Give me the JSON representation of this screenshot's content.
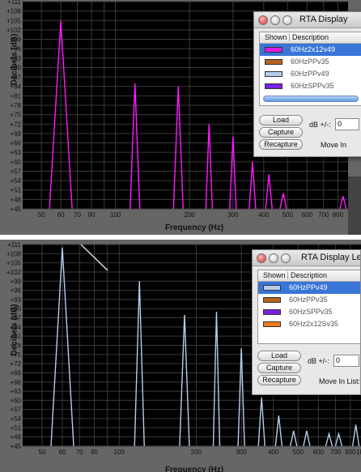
{
  "plot1": {
    "ylabel": "Decibels (dB)",
    "xlabel": "Frequency (Hz)",
    "y_ticks": [
      "+111",
      "+108",
      "+105",
      "+102",
      "+99",
      "+96",
      "+93",
      "+90",
      "+87",
      "+84",
      "+81",
      "+78",
      "+75",
      "+72",
      "+69",
      "+66",
      "+63",
      "+60",
      "+57",
      "+54",
      "+51",
      "+48",
      "+45"
    ],
    "x_ticks": [
      "50",
      "60",
      "70",
      "80",
      "100",
      "200",
      "300",
      "400",
      "500",
      "600",
      "700",
      "800"
    ],
    "trace_color": "#ff1aff"
  },
  "plot2": {
    "ylabel": "Decibels (dB)",
    "xlabel": "Frequency (Hz)",
    "y_ticks": [
      "+111",
      "+108",
      "+105",
      "+102",
      "+99",
      "+96",
      "+93",
      "+90",
      "+87",
      "+84",
      "+81",
      "+78",
      "+75",
      "+72",
      "+69",
      "+66",
      "+63",
      "+60",
      "+57",
      "+54",
      "+51",
      "+48",
      "+45"
    ],
    "x_ticks": [
      "50",
      "60",
      "70",
      "80",
      "100",
      "200",
      "300",
      "400",
      "500",
      "600",
      "700",
      "800",
      "1k"
    ],
    "trace_color": "#b4cdee"
  },
  "legend1": {
    "title": "RTA Display",
    "col_shown": "Shown",
    "col_desc": "Description",
    "rows": [
      {
        "desc": "60Hz2x12v49",
        "color": "#e01ce0",
        "selected": true
      },
      {
        "desc": "60HzPPv35",
        "color": "#b5651d",
        "selected": false
      },
      {
        "desc": "60HzPPv49",
        "color": "#b4cdee",
        "selected": false
      },
      {
        "desc": "60HzSPPv35",
        "color": "#7a1fe0",
        "selected": false
      }
    ],
    "load": "Load",
    "capture": "Capture",
    "recapture": "Recapture",
    "db_label": "dB +/-:",
    "db_value": "0",
    "move_label": "Move In"
  },
  "legend2": {
    "title": "RTA Display Leg",
    "col_shown": "Shown",
    "col_desc": "Description",
    "rows": [
      {
        "desc": "60HzPPv49",
        "color": "#b4cdee",
        "selected": true
      },
      {
        "desc": "60HzPPv35",
        "color": "#b5651d",
        "selected": false
      },
      {
        "desc": "60HzSPPv35",
        "color": "#7a1fe0",
        "selected": false
      },
      {
        "desc": "60Hz2x12Sv35",
        "color": "#f07a20",
        "selected": false
      }
    ],
    "load": "Load",
    "capture": "Capture",
    "recapture": "Recapture",
    "db_label": "dB +/-:",
    "db_value": "0",
    "move_label": "Move In List:"
  },
  "chart_data": [
    {
      "type": "line",
      "xlabel": "Frequency (Hz)",
      "ylabel": "Decibels (dB)",
      "ylim": [
        45,
        111
      ],
      "xscale": "log",
      "series": [
        {
          "name": "60Hz2x12v49",
          "peaks": [
            [
              60,
              105
            ],
            [
              120,
              85
            ],
            [
              180,
              84
            ],
            [
              240,
              72
            ],
            [
              300,
              68
            ],
            [
              360,
              60
            ],
            [
              420,
              56
            ],
            [
              480,
              50
            ],
            [
              840,
              49
            ]
          ]
        }
      ]
    },
    {
      "type": "line",
      "xlabel": "Frequency (Hz)",
      "ylabel": "Decibels (dB)",
      "ylim": [
        45,
        111
      ],
      "xscale": "log",
      "series": [
        {
          "name": "60HzPPv49",
          "peaks": [
            [
              60,
              110
            ],
            [
              120,
              99
            ],
            [
              180,
              88
            ],
            [
              240,
              89
            ],
            [
              300,
              77
            ],
            [
              360,
              61
            ],
            [
              420,
              55
            ],
            [
              480,
              50
            ],
            [
              540,
              50
            ],
            [
              660,
              49
            ],
            [
              720,
              49
            ],
            [
              840,
              52
            ]
          ]
        }
      ]
    }
  ]
}
